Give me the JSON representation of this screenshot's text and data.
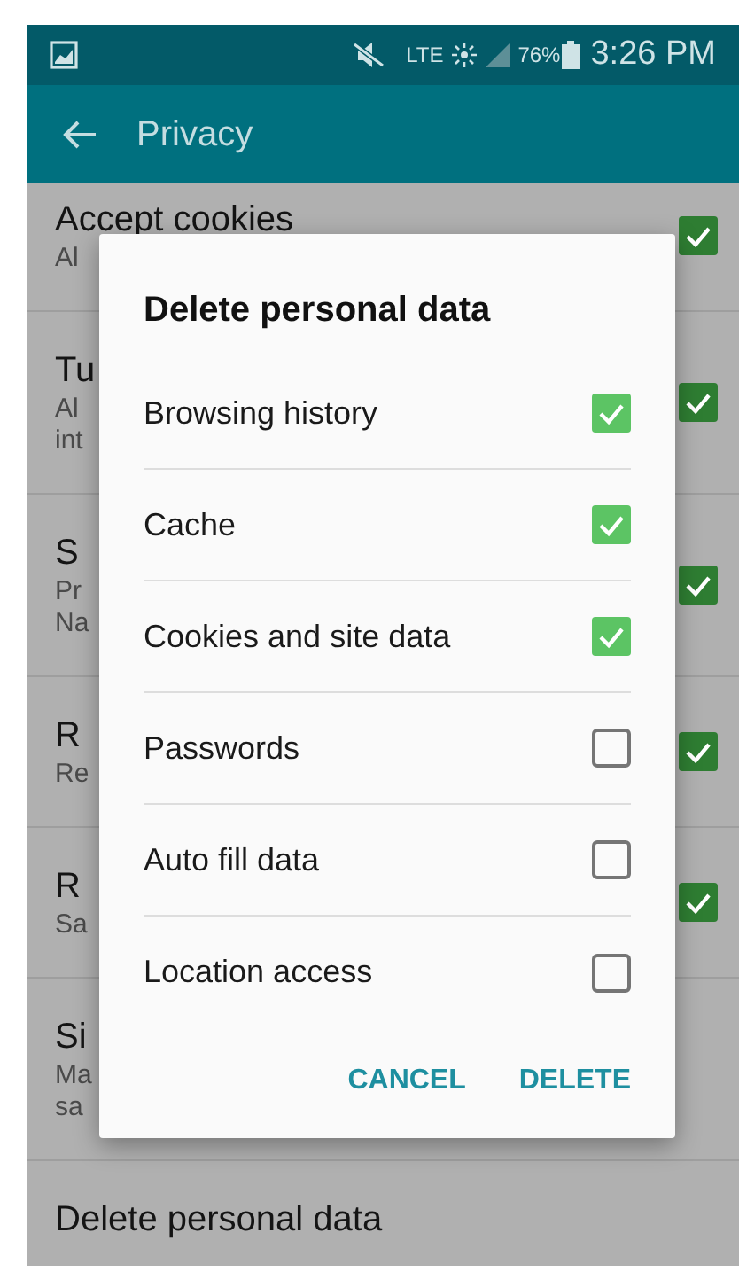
{
  "status_bar": {
    "network": "LTE",
    "battery": "76%",
    "time": "3:26 PM"
  },
  "toolbar": {
    "title": "Privacy"
  },
  "settings": [
    {
      "kind": "checkbox",
      "title": "Accept cookies",
      "summary": [
        "Al"
      ],
      "checked": true
    },
    {
      "kind": "checkbox",
      "title": "Tu",
      "summary": [
        "Al",
        "int"
      ],
      "checked": true
    },
    {
      "kind": "checkbox",
      "title": "S",
      "summary": [
        "Pr",
        "Na"
      ],
      "checked": true
    },
    {
      "kind": "checkbox",
      "title": "R",
      "summary": [
        "Re"
      ],
      "checked": true
    },
    {
      "kind": "checkbox",
      "title": "R",
      "summary": [
        "Sa"
      ],
      "checked": true
    },
    {
      "kind": "plain",
      "title": "Si",
      "summary": [
        "Ma",
        "sa"
      ]
    },
    {
      "kind": "plain",
      "title": "Delete personal data"
    }
  ],
  "dialog": {
    "title": "Delete personal data",
    "options": [
      {
        "label": "Browsing history",
        "checked": true
      },
      {
        "label": "Cache",
        "checked": true
      },
      {
        "label": "Cookies and site data",
        "checked": true
      },
      {
        "label": "Passwords",
        "checked": false
      },
      {
        "label": "Auto fill data",
        "checked": false
      },
      {
        "label": "Location access",
        "checked": false
      }
    ],
    "buttons": [
      "CANCEL",
      "DELETE"
    ]
  }
}
